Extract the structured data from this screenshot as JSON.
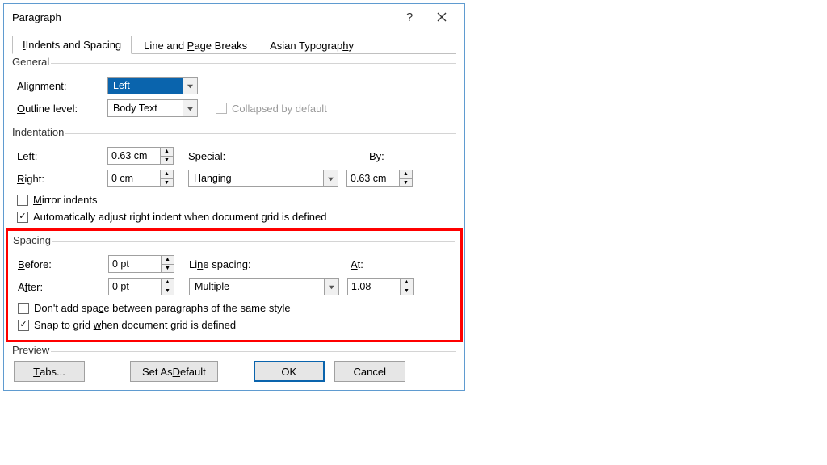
{
  "title": "Paragraph",
  "tabs": {
    "indents": "Indents and Spacing",
    "line": "Line and Page Breaks",
    "asian": "Asian Typography"
  },
  "general": {
    "title": "General",
    "alignment_label": "Alignment:",
    "alignment_value": "Left",
    "outline_label": "Outline level:",
    "outline_value": "Body Text",
    "collapsed_label": "Collapsed by default"
  },
  "indent": {
    "title": "Indentation",
    "left_label": "Left:",
    "left_value": "0.63 cm",
    "right_label": "Right:",
    "right_value": "0 cm",
    "special_label": "Special:",
    "special_value": "Hanging",
    "by_label": "By:",
    "by_value": "0.63 cm",
    "mirror_label": "Mirror indents",
    "auto_label": "Automatically adjust right indent when document grid is defined"
  },
  "spacing": {
    "title": "Spacing",
    "before_label": "Before:",
    "before_value": "0 pt",
    "after_label": "After:",
    "after_value": "0 pt",
    "ls_label": "Line spacing:",
    "ls_value": "Multiple",
    "at_label": "At:",
    "at_value": "1.08",
    "noadd_label": "Don't add space between paragraphs of the same style",
    "snap_label": "Snap to grid when document grid is defined"
  },
  "preview": {
    "title": "Preview"
  },
  "buttons": {
    "tabs": "Tabs...",
    "default": "Set As Default",
    "ok": "OK",
    "cancel": "Cancel"
  }
}
